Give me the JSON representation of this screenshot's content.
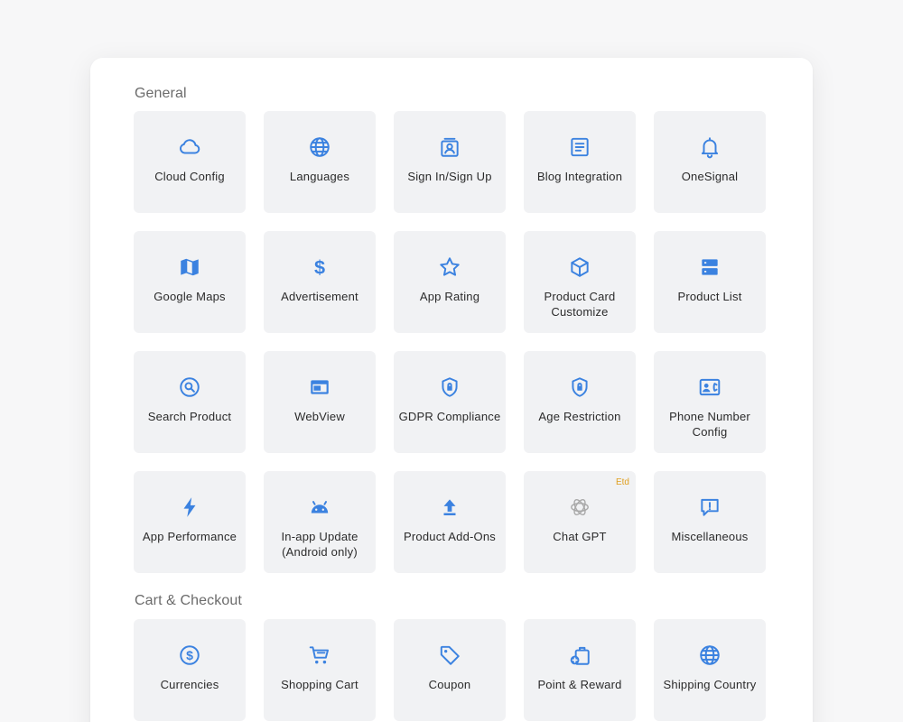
{
  "colors": {
    "accent": "#3b82e0",
    "tile_bg": "#f1f2f4",
    "badge": "#e0a020"
  },
  "sections": {
    "general": {
      "title": "General",
      "items": [
        {
          "label": "Cloud Config",
          "icon": "cloud-icon"
        },
        {
          "label": "Languages",
          "icon": "globe-icon"
        },
        {
          "label": "Sign In/Sign Up",
          "icon": "user-card-icon"
        },
        {
          "label": "Blog Integration",
          "icon": "article-icon"
        },
        {
          "label": "OneSignal",
          "icon": "bell-icon"
        },
        {
          "label": "Google Maps",
          "icon": "map-icon"
        },
        {
          "label": "Advertisement",
          "icon": "dollar-icon"
        },
        {
          "label": "App Rating",
          "icon": "star-icon"
        },
        {
          "label": "Product Card\nCustomize",
          "icon": "cube-icon"
        },
        {
          "label": "Product List",
          "icon": "list-icon"
        },
        {
          "label": "Search Product",
          "icon": "search-icon"
        },
        {
          "label": "WebView",
          "icon": "webview-icon"
        },
        {
          "label": "GDPR Compliance",
          "icon": "shield-lock-icon"
        },
        {
          "label": "Age Restriction",
          "icon": "shield-lock-icon"
        },
        {
          "label": "Phone Number\nConfig",
          "icon": "contact-phone-icon"
        },
        {
          "label": "App Performance",
          "icon": "bolt-icon"
        },
        {
          "label": "In-app Update\n(Android only)",
          "icon": "android-icon"
        },
        {
          "label": "Product Add-Ons",
          "icon": "upload-icon"
        },
        {
          "label": "Chat GPT",
          "icon": "chatgpt-icon",
          "badge": "Etd"
        },
        {
          "label": "Miscellaneous",
          "icon": "alert-chat-icon"
        }
      ]
    },
    "cart": {
      "title": "Cart & Checkout",
      "items": [
        {
          "label": "Currencies",
          "icon": "currency-icon"
        },
        {
          "label": "Shopping Cart",
          "icon": "cart-icon"
        },
        {
          "label": "Coupon",
          "icon": "tag-icon"
        },
        {
          "label": "Point & Reward",
          "icon": "reward-icon"
        },
        {
          "label": "Shipping Country",
          "icon": "globe-icon"
        }
      ]
    }
  }
}
